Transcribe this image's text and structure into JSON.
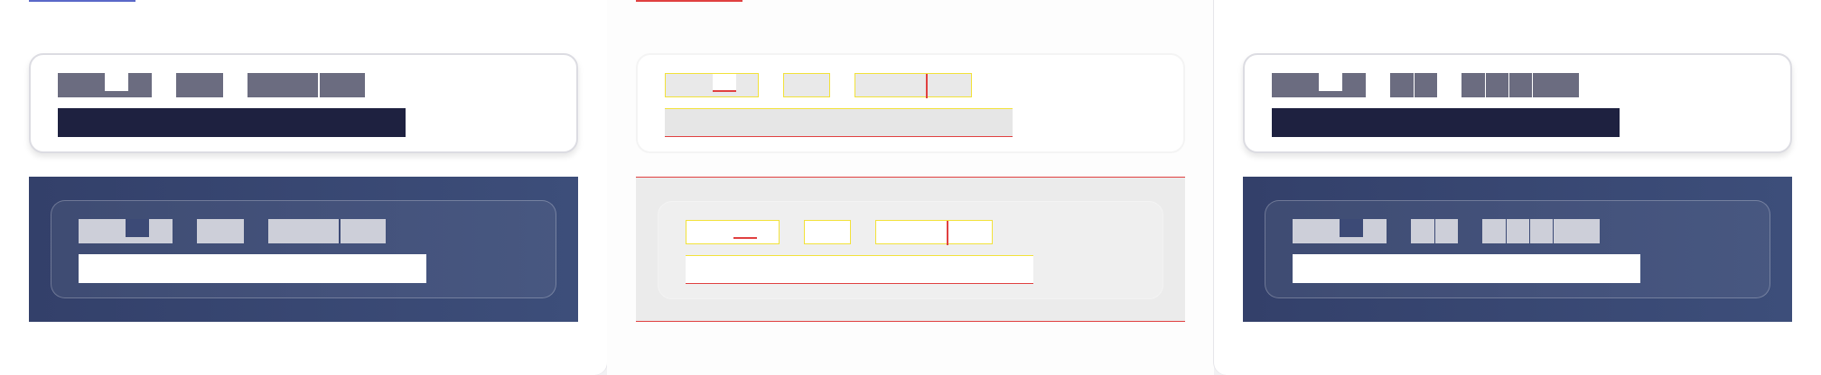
{
  "colors": {
    "page_background": "#f2f2f4",
    "panel_background": "#ffffff",
    "skeleton_block": "#6b6c80",
    "skeleton_bar_dark": "#1e2140",
    "section_gradient_start": "#33406a",
    "section_gradient_end": "#3d4e7a",
    "section_skeleton_block": "#cdcfd9",
    "accent_line_blue": "#5a68c8",
    "debug_outline_red": "#e04040",
    "debug_outline_yellow": "#f2e23a"
  },
  "panels": [
    {
      "variant": "default"
    },
    {
      "variant": "debug-outline"
    },
    {
      "variant": "default-segmented"
    }
  ]
}
